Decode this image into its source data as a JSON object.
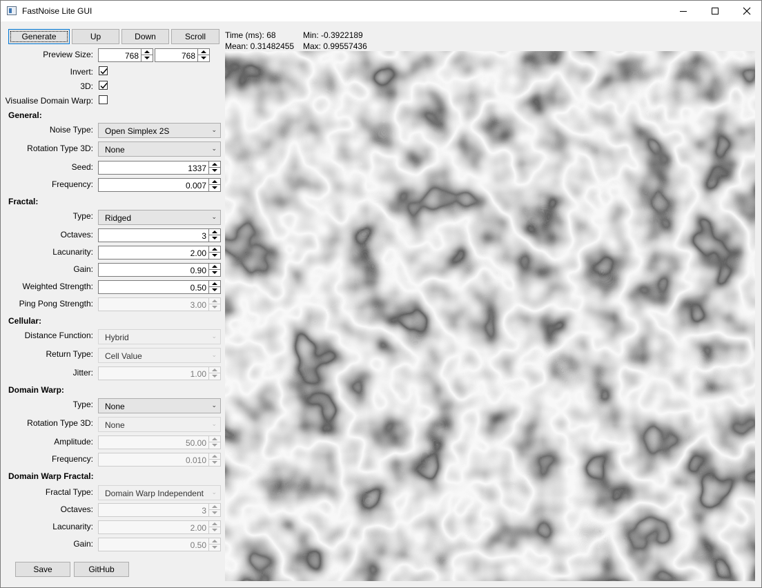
{
  "window": {
    "title": "FastNoise Lite GUI",
    "minimize_icon": "minimize-icon",
    "maximize_icon": "maximize-icon",
    "close_icon": "close-icon"
  },
  "toolbar": {
    "generate_label": "Generate",
    "up_label": "Up",
    "down_label": "Down",
    "scroll_label": "Scroll"
  },
  "stats": {
    "time": "Time (ms): 68",
    "mean": "Mean: 0.31482455",
    "min": "Min: -0.3922189",
    "max": "Max: 0.99557436"
  },
  "preview_settings": {
    "size_label": "Preview Size:",
    "width": "768",
    "height": "768",
    "invert_label": "Invert:",
    "invert": true,
    "three_d_label": "3D:",
    "three_d": true,
    "visualise_label": "Visualise Domain Warp:",
    "visualise": false
  },
  "general": {
    "header": "General:",
    "noise_type_label": "Noise Type:",
    "noise_type": "Open Simplex 2S",
    "rotation_label": "Rotation Type 3D:",
    "rotation": "None",
    "seed_label": "Seed:",
    "seed": "1337",
    "frequency_label": "Frequency:",
    "frequency": "0.007"
  },
  "fractal": {
    "header": "Fractal:",
    "type_label": "Type:",
    "type": "Ridged",
    "octaves_label": "Octaves:",
    "octaves": "3",
    "lacunarity_label": "Lacunarity:",
    "lacunarity": "2.00",
    "gain_label": "Gain:",
    "gain": "0.90",
    "weighted_label": "Weighted Strength:",
    "weighted": "0.50",
    "pingpong_label": "Ping Pong Strength:",
    "pingpong": "3.00"
  },
  "cellular": {
    "header": "Cellular:",
    "distance_label": "Distance Function:",
    "distance": "Hybrid",
    "return_label": "Return Type:",
    "return": "Cell Value",
    "jitter_label": "Jitter:",
    "jitter": "1.00"
  },
  "domain_warp": {
    "header": "Domain Warp:",
    "type_label": "Type:",
    "type": "None",
    "rotation_label": "Rotation Type 3D:",
    "rotation": "None",
    "amplitude_label": "Amplitude:",
    "amplitude": "50.00",
    "frequency_label": "Frequency:",
    "frequency": "0.010"
  },
  "domain_warp_fractal": {
    "header": "Domain Warp Fractal:",
    "type_label": "Fractal Type:",
    "type": "Domain Warp Independent",
    "octaves_label": "Octaves:",
    "octaves": "3",
    "lacunarity_label": "Lacunarity:",
    "lacunarity": "2.00",
    "gain_label": "Gain:",
    "gain": "0.50"
  },
  "footer": {
    "save_label": "Save",
    "github_label": "GitHub"
  }
}
